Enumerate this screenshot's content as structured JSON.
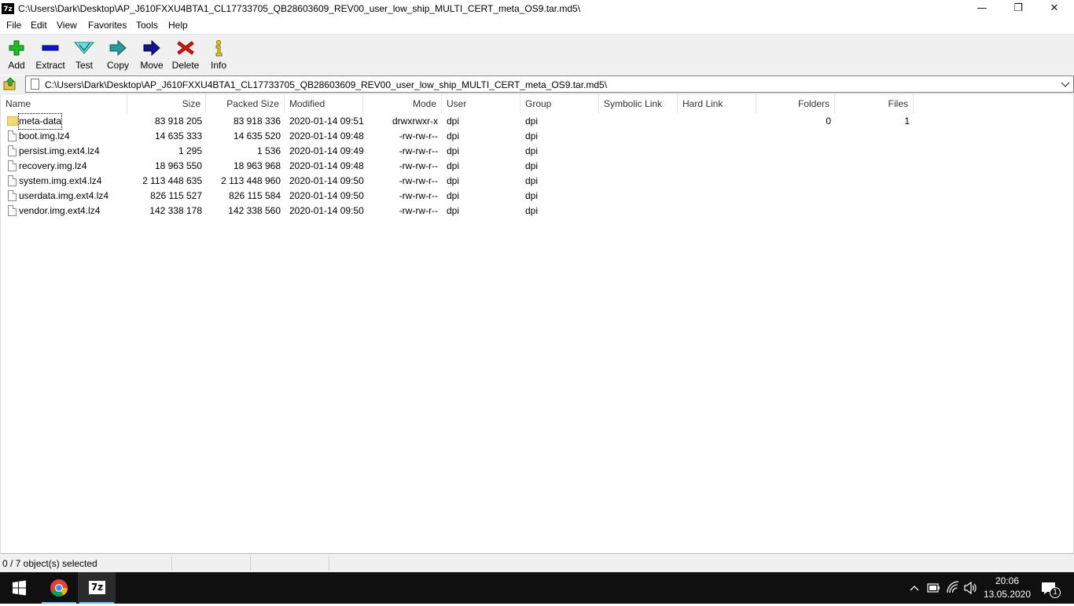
{
  "window": {
    "title": "C:\\Users\\Dark\\Desktop\\AP_J610FXXU4BTA1_CL17733705_QB28603609_REV00_user_low_ship_MULTI_CERT_meta_OS9.tar.md5\\",
    "app_icon_text": "7z",
    "controls": {
      "minimize": "—",
      "maximize": "❐",
      "close": "✕"
    }
  },
  "menu": [
    "File",
    "Edit",
    "View",
    "Favorites",
    "Tools",
    "Help"
  ],
  "toolbar": {
    "add": "Add",
    "extract": "Extract",
    "test": "Test",
    "copy": "Copy",
    "move": "Move",
    "delete": "Delete",
    "info": "Info"
  },
  "address": {
    "path": "C:\\Users\\Dark\\Desktop\\AP_J610FXXU4BTA1_CL17733705_QB28603609_REV00_user_low_ship_MULTI_CERT_meta_OS9.tar.md5\\"
  },
  "columns": [
    "Name",
    "Size",
    "Packed Size",
    "Modified",
    "Mode",
    "User",
    "Group",
    "Symbolic Link",
    "Hard Link",
    "Folders",
    "Files"
  ],
  "rows": [
    {
      "type": "folder",
      "name": "meta-data",
      "size": "83 918 205",
      "packed": "83 918 336",
      "modified": "2020-01-14 09:51",
      "mode": "drwxrwxr-x",
      "user": "dpi",
      "group": "dpi",
      "folders": "0",
      "files": "1"
    },
    {
      "type": "file",
      "name": "boot.img.lz4",
      "size": "14 635 333",
      "packed": "14 635 520",
      "modified": "2020-01-14 09:48",
      "mode": "-rw-rw-r--",
      "user": "dpi",
      "group": "dpi",
      "folders": "",
      "files": ""
    },
    {
      "type": "file",
      "name": "persist.img.ext4.lz4",
      "size": "1 295",
      "packed": "1 536",
      "modified": "2020-01-14 09:49",
      "mode": "-rw-rw-r--",
      "user": "dpi",
      "group": "dpi",
      "folders": "",
      "files": ""
    },
    {
      "type": "file",
      "name": "recovery.img.lz4",
      "size": "18 963 550",
      "packed": "18 963 968",
      "modified": "2020-01-14 09:48",
      "mode": "-rw-rw-r--",
      "user": "dpi",
      "group": "dpi",
      "folders": "",
      "files": ""
    },
    {
      "type": "file",
      "name": "system.img.ext4.lz4",
      "size": "2 113 448 635",
      "packed": "2 113 448 960",
      "modified": "2020-01-14 09:50",
      "mode": "-rw-rw-r--",
      "user": "dpi",
      "group": "dpi",
      "folders": "",
      "files": ""
    },
    {
      "type": "file",
      "name": "userdata.img.ext4.lz4",
      "size": "826 115 527",
      "packed": "826 115 584",
      "modified": "2020-01-14 09:50",
      "mode": "-rw-rw-r--",
      "user": "dpi",
      "group": "dpi",
      "folders": "",
      "files": ""
    },
    {
      "type": "file",
      "name": "vendor.img.ext4.lz4",
      "size": "142 338 178",
      "packed": "142 338 560",
      "modified": "2020-01-14 09:50",
      "mode": "-rw-rw-r--",
      "user": "dpi",
      "group": "dpi",
      "folders": "",
      "files": ""
    }
  ],
  "status": {
    "selection": "0 / 7 object(s) selected",
    "part2": "",
    "part3": ""
  },
  "taskbar": {
    "apps": [
      "start-icon",
      "chrome-icon",
      "7zip-icon"
    ],
    "app_7z_text": "7z",
    "clock_time": "20:06",
    "clock_date": "13.05.2020",
    "notification_count": "1"
  },
  "colors": {
    "toolbar_bg": "#f0f0f0",
    "taskbar_bg": "#101010",
    "folder": "#f7d674",
    "accent": "#76b9ed"
  }
}
